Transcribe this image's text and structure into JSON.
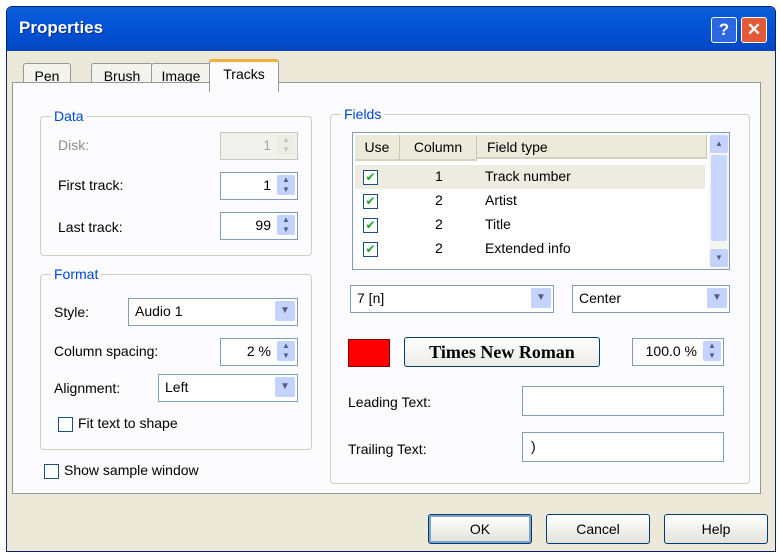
{
  "window": {
    "title": "Properties",
    "help_glyph": "?",
    "close_glyph": "✕"
  },
  "tabs": [
    {
      "label": "Pen",
      "active": false
    },
    {
      "label": "Brush",
      "active": false
    },
    {
      "label": "Image",
      "active": false
    },
    {
      "label": "Tracks",
      "active": true
    }
  ],
  "data_group": {
    "label": "Data",
    "disk": {
      "label": "Disk:",
      "value": "1",
      "enabled": false
    },
    "first_track": {
      "label": "First track:",
      "value": "1"
    },
    "last_track": {
      "label": "Last track:",
      "value": "99"
    }
  },
  "format_group": {
    "label": "Format",
    "style": {
      "label": "Style:",
      "value": "Audio 1"
    },
    "column_spacing": {
      "label": "Column spacing:",
      "value": "2 %"
    },
    "alignment": {
      "label": "Alignment:",
      "value": "Left"
    },
    "fit_text": {
      "label": "Fit text to shape",
      "checked": false
    }
  },
  "show_sample": {
    "label": "Show sample window",
    "checked": false
  },
  "fields_group": {
    "label": "Fields",
    "columns": [
      "Use",
      "Column",
      "Field type"
    ],
    "rows": [
      {
        "use": true,
        "column": "1",
        "field_type": "Track number",
        "selected": true
      },
      {
        "use": true,
        "column": "2",
        "field_type": "Artist",
        "selected": false
      },
      {
        "use": true,
        "column": "2",
        "field_type": "Title",
        "selected": false
      },
      {
        "use": true,
        "column": "2",
        "field_type": "Extended info",
        "selected": false
      }
    ],
    "format_combo": {
      "value": "7 [n]"
    },
    "align_combo": {
      "value": "Center"
    },
    "color_swatch": "#ff0000",
    "font_button": {
      "label": "Times New Roman"
    },
    "scale": {
      "value": "100.0 %"
    },
    "leading_text": {
      "label": "Leading Text:",
      "value": ""
    },
    "trailing_text": {
      "label": "Trailing Text:",
      "value": ")"
    }
  },
  "buttons": {
    "ok": "OK",
    "cancel": "Cancel",
    "help": "Help"
  },
  "glyphs": {
    "check": "✔",
    "spin_up": "▲",
    "spin_down": "▼",
    "dropdown": "▼",
    "scroll_up": "▲",
    "scroll_down": "▼"
  }
}
